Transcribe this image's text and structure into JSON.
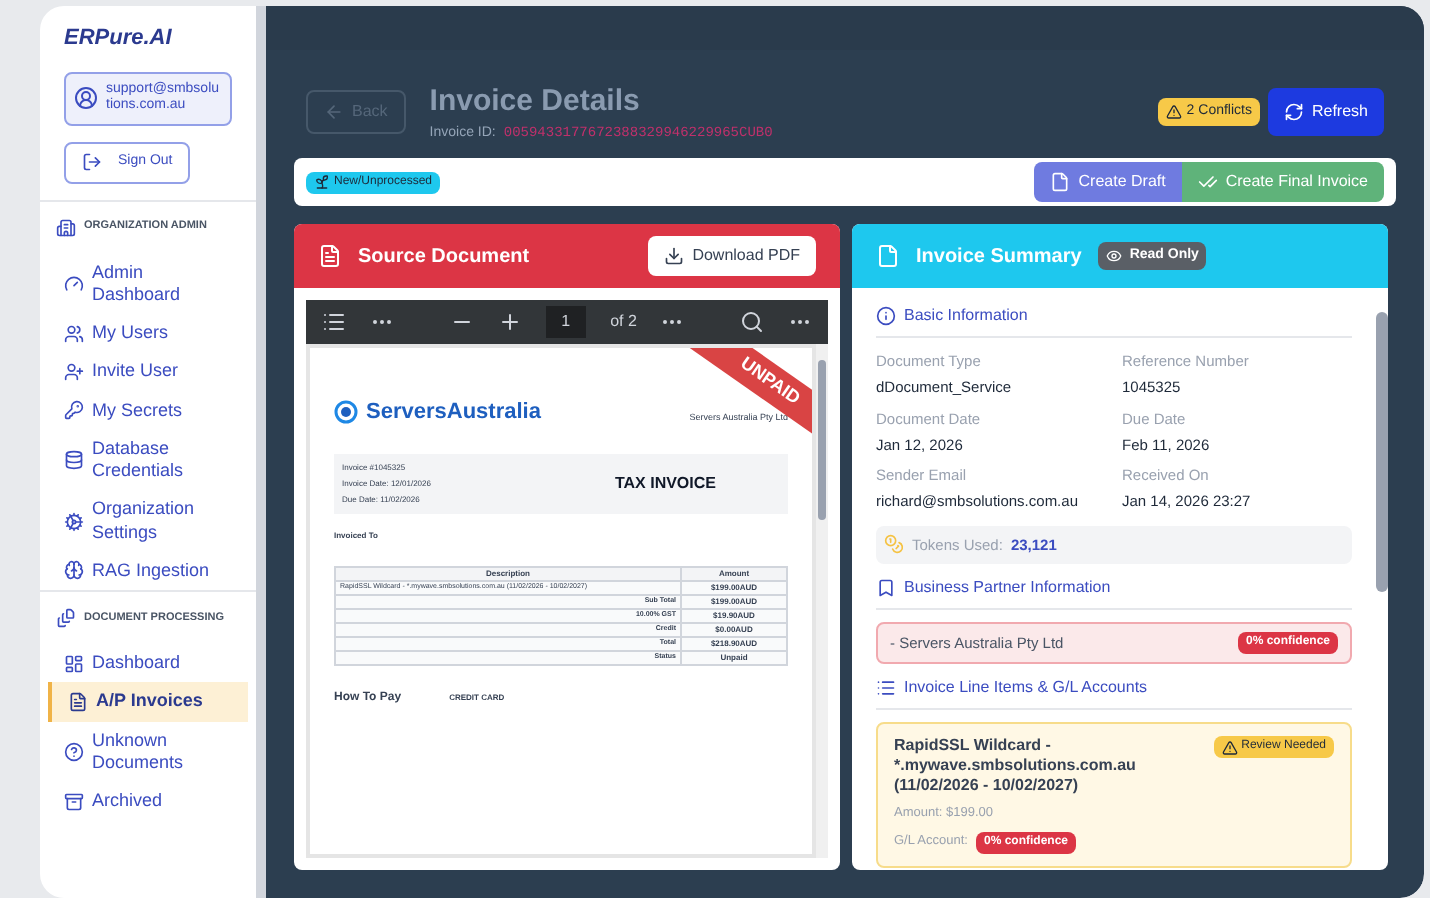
{
  "sidebar": {
    "logo": "ERPure.AI",
    "user_email": "support@smbsolutions.com.au",
    "sign_out": "Sign Out",
    "sections": [
      {
        "title": "ORGANIZATION ADMIN",
        "items": [
          {
            "label": "Admin Dashboard",
            "selected": false
          },
          {
            "label": "My Users",
            "selected": false
          },
          {
            "label": "Invite User",
            "selected": false
          },
          {
            "label": "My Secrets",
            "selected": false
          },
          {
            "label": "Database Credentials",
            "selected": false
          },
          {
            "label": "Organization Settings",
            "selected": false
          },
          {
            "label": "RAG Ingestion",
            "selected": false
          }
        ]
      },
      {
        "title": "DOCUMENT PROCESSING",
        "items": [
          {
            "label": "Dashboard",
            "selected": false
          },
          {
            "label": "A/P Invoices",
            "selected": true
          },
          {
            "label": "Unknown Documents",
            "selected": false
          },
          {
            "label": "Archived",
            "selected": false
          }
        ]
      }
    ]
  },
  "header": {
    "back": "Back",
    "title": "Invoice Details",
    "id_label": "Invoice ID:",
    "id_value": "0059433177672388329946229965CUB0",
    "conflicts": "2 Conflicts",
    "refresh": "Refresh"
  },
  "toolbar": {
    "status": "New/Unprocessed",
    "create_draft": "Create Draft",
    "create_final": "Create Final Invoice"
  },
  "source": {
    "title": "Source Document",
    "download": "Download PDF",
    "viewer": {
      "page": "1",
      "page_count": "of 2"
    },
    "document": {
      "stamp": "UNPAID",
      "brand": "ServersAustralia",
      "company": "Servers Australia Pty Ltd",
      "heading": "TAX INVOICE",
      "meta": [
        "Invoice #1045325",
        "Invoice Date: 12/01/2026",
        "Due Date: 11/02/2026"
      ],
      "invoiced_to": "Invoiced To",
      "columns": [
        "Description",
        "Amount"
      ],
      "rows": [
        {
          "label": "RapidSSL Wildcard - *.mywave.smbsolutions.com.au (11/02/2026 - 10/02/2027)",
          "amount": "$199.00AUD"
        },
        {
          "label": "Sub Total",
          "amount": "$199.00AUD"
        },
        {
          "label": "10.00% GST",
          "amount": "$19.90AUD"
        },
        {
          "label": "Credit",
          "amount": "$0.00AUD"
        },
        {
          "label": "Total",
          "amount": "$218.90AUD"
        },
        {
          "label": "Status",
          "amount": "Unpaid"
        }
      ],
      "how_to_pay": "How To Pay",
      "credit_card": "CREDIT CARD"
    }
  },
  "summary": {
    "title": "Invoice Summary",
    "read_only": "Read Only",
    "basic_info": "Basic Information",
    "fields": [
      {
        "label": "Document Type",
        "value": "dDocument_Service"
      },
      {
        "label": "Reference Number",
        "value": "1045325"
      },
      {
        "label": "Document Date",
        "value": "Jan 12, 2026"
      },
      {
        "label": "Due Date",
        "value": "Feb 11, 2026"
      },
      {
        "label": "Sender Email",
        "value": "richard@smbsolutions.com.au"
      },
      {
        "label": "Received On",
        "value": "Jan 14, 2026 23:27"
      }
    ],
    "tokens_label": "Tokens Used:",
    "tokens_value": "23,121",
    "partner_heading": "Business Partner Information",
    "partner": "- Servers Australia Pty Ltd",
    "partner_confidence": "0% confidence",
    "lines_heading": "Invoice Line Items & G/L Accounts",
    "line_item": {
      "title": "RapidSSL Wildcard - *.mywave.smbsolutions.com.au (11/02/2026 - 10/02/2027)",
      "status": "Review Needed",
      "amount": "Amount: $199.00",
      "gl_label": "G/L Account:",
      "gl_confidence": "0% confidence"
    }
  }
}
